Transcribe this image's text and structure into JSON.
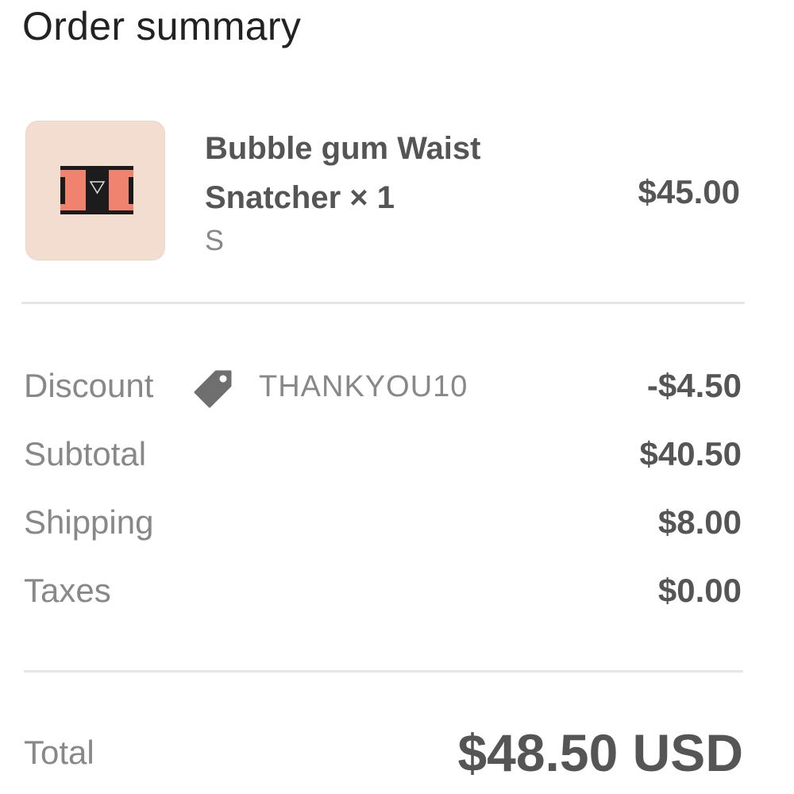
{
  "title": "Order summary",
  "product": {
    "name": "Bubble gum Waist Snatcher × 1",
    "variant": "S",
    "price": "$45.00",
    "thumbnail_icon": "waist-trainer-product-image"
  },
  "discount": {
    "label": "Discount",
    "code": "THANKYOU10",
    "value": "-$4.50",
    "icon": "tag-icon"
  },
  "subtotal": {
    "label": "Subtotal",
    "value": "$40.50"
  },
  "shipping": {
    "label": "Shipping",
    "value": "$8.00"
  },
  "taxes": {
    "label": "Taxes",
    "value": "$0.00"
  },
  "total": {
    "label": "Total",
    "value": "$48.50 USD"
  },
  "colors": {
    "background": "#ffffff",
    "text_primary": "#555555",
    "text_secondary": "#888888",
    "divider": "#e6e6e6",
    "thumbnail_bg": "#f3ddd1",
    "product_pink": "#f0836f"
  }
}
